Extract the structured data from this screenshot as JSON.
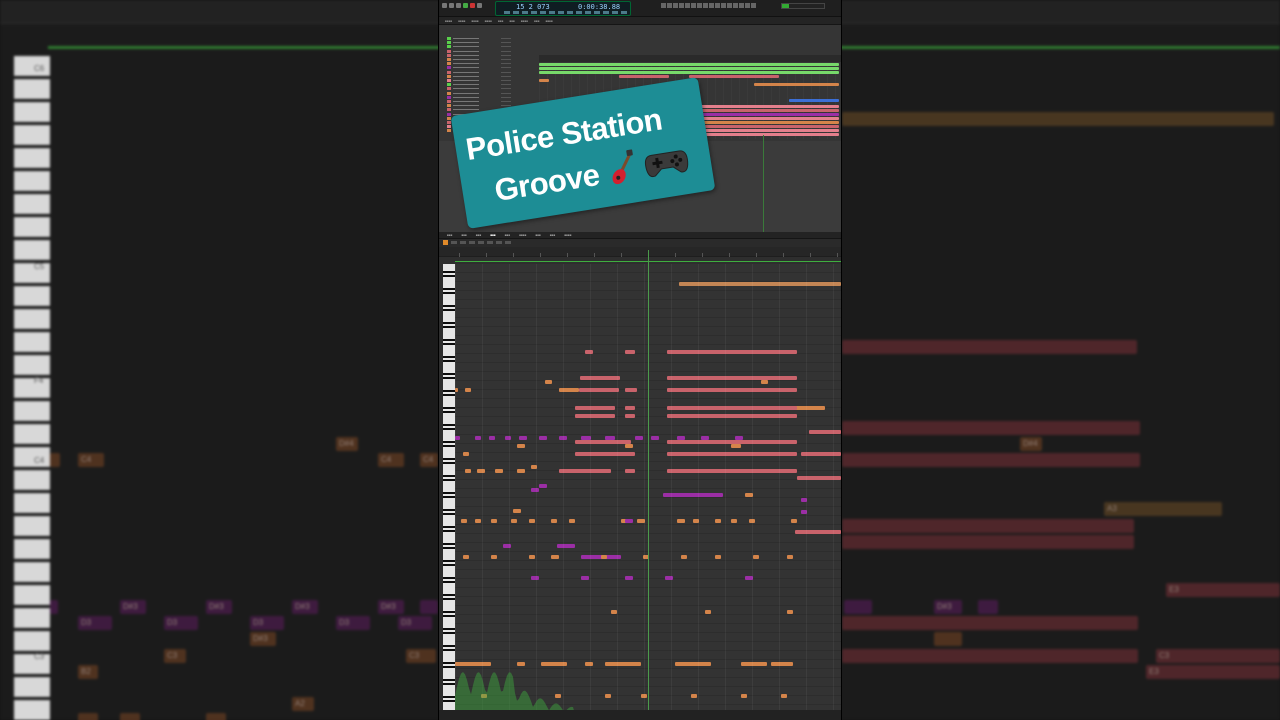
{
  "overlay": {
    "line1": "Police Station",
    "line2": "Groove",
    "emoji_guitar": "guitar-icon",
    "emoji_gamepad": "gamepad-icon",
    "badge_color": "#1d8d95"
  },
  "transport": {
    "bars": "15 2 073",
    "time": "0:00:38.88"
  },
  "background_labels": {
    "octaves": [
      "C6",
      "C5",
      "F4",
      "C4",
      "C3"
    ],
    "notes": [
      "D#4",
      "C4",
      "C4",
      "C4",
      "D#4",
      "D#3",
      "D#3",
      "D#3",
      "D#3",
      "D3",
      "D3",
      "D3",
      "D3",
      "D3",
      "D#3",
      "D#3",
      "C3",
      "C3",
      "C3",
      "B2",
      "A2",
      "A3",
      "E3",
      "E3"
    ]
  },
  "colors": {
    "orange": "#d4844a",
    "purple": "#9b2ea5",
    "red": "#c9636b",
    "pink": "#e47f8c",
    "green": "#3fae3f"
  }
}
